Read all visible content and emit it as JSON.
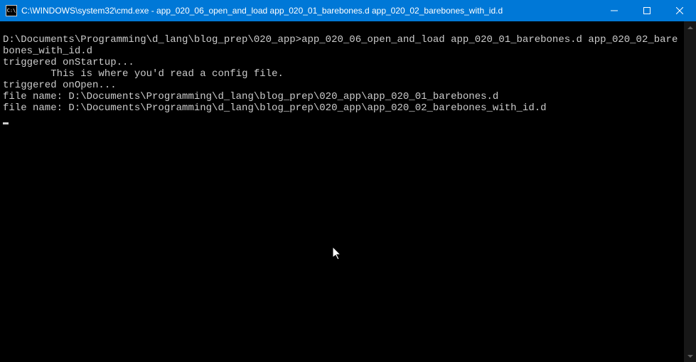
{
  "titlebar": {
    "icon_text": "C:\\",
    "title": "C:\\WINDOWS\\system32\\cmd.exe - app_020_06_open_and_load  app_020_01_barebones.d app_020_02_barebones_with_id.d"
  },
  "console": {
    "blank": " ",
    "prompt": "D:\\Documents\\Programming\\d_lang\\blog_prep\\020_app>",
    "command": "app_020_06_open_and_load app_020_01_barebones.d app_020_02_barebones_with_id.d",
    "lines": [
      "triggered onStartup...",
      "        This is where you'd read a config file.",
      "triggered onOpen...",
      "file name: D:\\Documents\\Programming\\d_lang\\blog_prep\\020_app\\app_020_01_barebones.d",
      "file name: D:\\Documents\\Programming\\d_lang\\blog_prep\\020_app\\app_020_02_barebones_with_id.d"
    ]
  }
}
